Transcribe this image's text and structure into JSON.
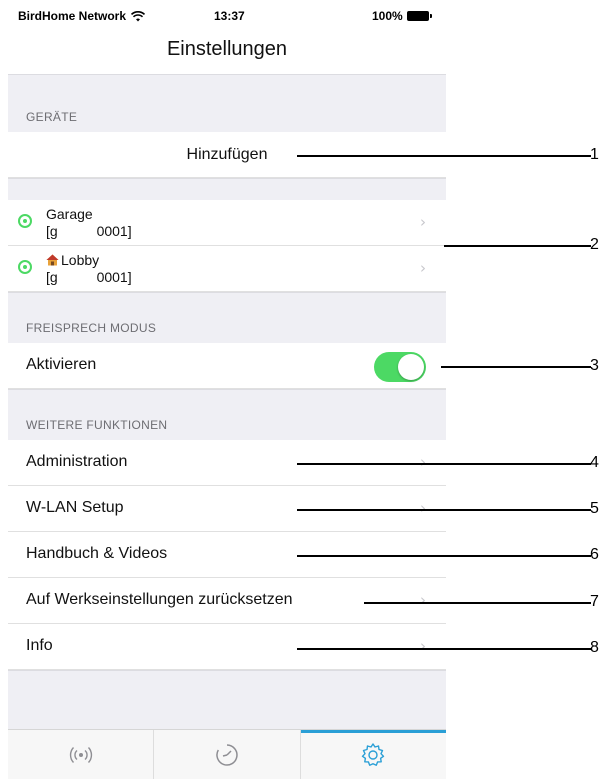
{
  "status_bar": {
    "carrier": "BirdHome Network",
    "time": "13:37",
    "battery": "100%"
  },
  "nav": {
    "title": "Einstellungen"
  },
  "sections": {
    "devices_header": "GERÄTE",
    "add_label": "Hinzufügen",
    "devices": [
      {
        "name": "Garage",
        "id": "[g          0001]",
        "icon": "none"
      },
      {
        "name": "Lobby",
        "id": "[g          0001]",
        "icon": "house-icon"
      }
    ],
    "handsfree_header": "FREISPRECH MODUS",
    "activate_label": "Aktivieren",
    "activate_on": true,
    "more_header": "WEITERE FUNKTIONEN",
    "items": [
      {
        "label": "Administration"
      },
      {
        "label": "W-LAN Setup"
      },
      {
        "label": "Handbuch & Videos"
      },
      {
        "label": "Auf Werkseinstellungen zurücksetzen"
      },
      {
        "label": "Info"
      }
    ]
  },
  "tabs": [
    {
      "icon": "broadcast-icon",
      "active": false
    },
    {
      "icon": "history-clock-icon",
      "active": false
    },
    {
      "icon": "settings-gear-icon",
      "active": true
    }
  ],
  "callouts": [
    "1",
    "2",
    "3",
    "4",
    "5",
    "6",
    "7",
    "8"
  ],
  "colors": {
    "accent": "#2a9fd6",
    "toggle_on": "#4cd964",
    "section_bg": "#efeff4"
  }
}
